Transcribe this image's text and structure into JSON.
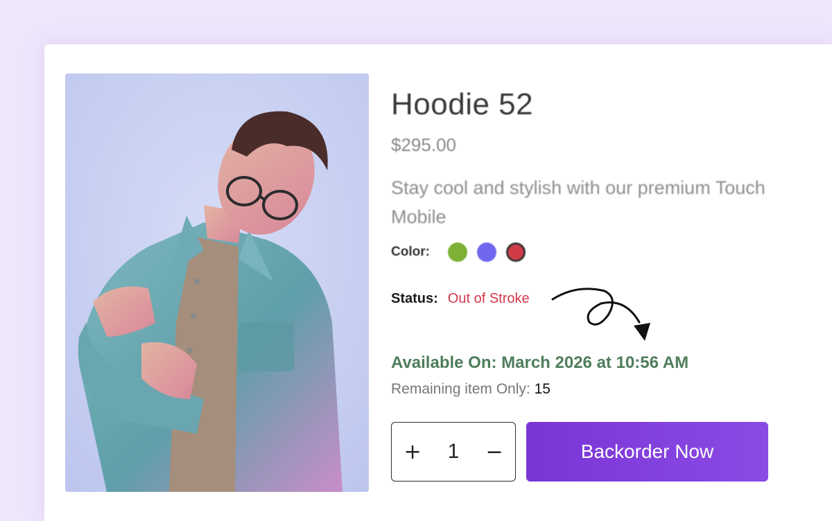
{
  "product": {
    "title": "Hoodie 52",
    "price": "$295.00",
    "description": "Stay cool and stylish with our premium Touch Mobile",
    "color_label": "Color:",
    "colors": [
      {
        "name": "green",
        "hex": "#7fb036"
      },
      {
        "name": "blue",
        "hex": "#6f68ef"
      },
      {
        "name": "red",
        "hex": "#d23a48",
        "selected": true
      }
    ],
    "status_label": "Status:",
    "status_value": "Out of Stroke",
    "available_on": "Available On: March 2026 at 10:56 AM",
    "remaining_label": "Remaining item Only: ",
    "remaining_count": "15"
  },
  "quantity": {
    "plus": "+",
    "value": "1",
    "minus": "−"
  },
  "actions": {
    "backorder_label": "Backorder Now"
  },
  "theme": {
    "accent": "#7a35d6",
    "status_color": "#d4374a",
    "available_color": "#4f7d5b"
  }
}
